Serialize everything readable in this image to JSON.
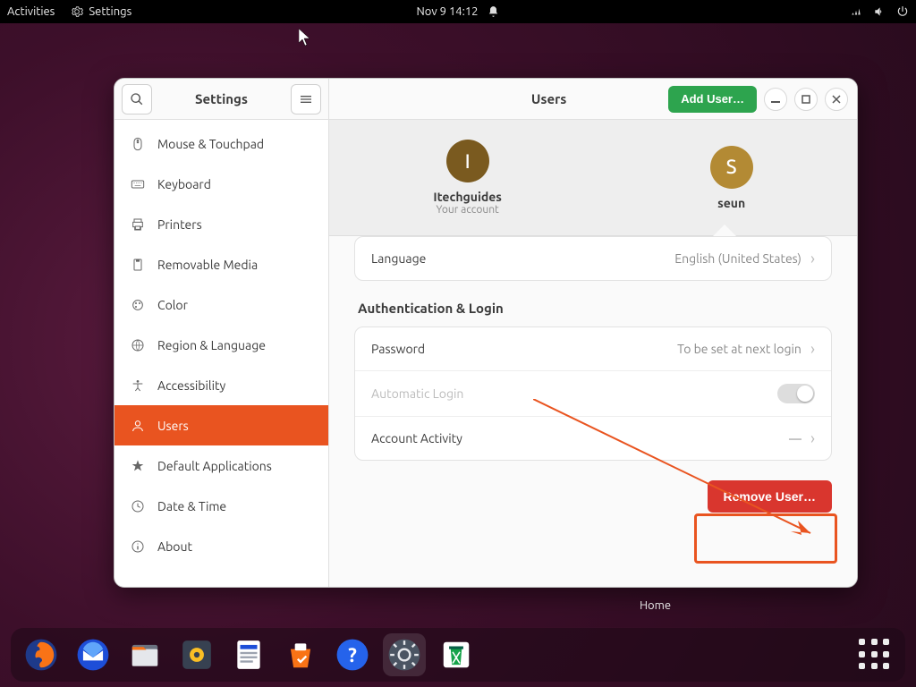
{
  "topbar": {
    "activities": "Activities",
    "app_name": "Settings",
    "datetime": "Nov 9  14:12"
  },
  "sidebar": {
    "title": "Settings",
    "items": [
      {
        "label": "Mouse & Touchpad",
        "icon": "mouse-icon"
      },
      {
        "label": "Keyboard",
        "icon": "keyboard-icon"
      },
      {
        "label": "Printers",
        "icon": "printer-icon"
      },
      {
        "label": "Removable Media",
        "icon": "removable-media-icon"
      },
      {
        "label": "Color",
        "icon": "color-icon"
      },
      {
        "label": "Region & Language",
        "icon": "globe-icon"
      },
      {
        "label": "Accessibility",
        "icon": "accessibility-icon"
      },
      {
        "label": "Users",
        "icon": "users-icon",
        "active": true
      },
      {
        "label": "Default Applications",
        "icon": "star-icon"
      },
      {
        "label": "Date & Time",
        "icon": "clock-icon"
      },
      {
        "label": "About",
        "icon": "info-icon"
      }
    ]
  },
  "content": {
    "title": "Users",
    "add_user": "Add User…",
    "users": [
      {
        "initial": "I",
        "name": "Itechguides",
        "sub": "Your account"
      },
      {
        "initial": "S",
        "name": "seun",
        "sub": ""
      }
    ],
    "language_row": {
      "label": "Language",
      "value": "English (United States)"
    },
    "auth_section": "Authentication & Login",
    "password_row": {
      "label": "Password",
      "value": "To be set at next login"
    },
    "autologin_row": {
      "label": "Automatic Login"
    },
    "activity_row": {
      "label": "Account Activity",
      "value": "—"
    },
    "remove_user": "Remove User…"
  },
  "desktop": {
    "home_icon_label": "Home"
  },
  "dock": {
    "items": [
      {
        "name": "firefox"
      },
      {
        "name": "thunderbird"
      },
      {
        "name": "files"
      },
      {
        "name": "rhythmbox"
      },
      {
        "name": "libreoffice-writer"
      },
      {
        "name": "ubuntu-software"
      },
      {
        "name": "help"
      },
      {
        "name": "settings",
        "active": true
      },
      {
        "name": "trash"
      }
    ]
  },
  "colors": {
    "accent": "#e95420",
    "green": "#2da44e",
    "danger": "#d9362e"
  }
}
